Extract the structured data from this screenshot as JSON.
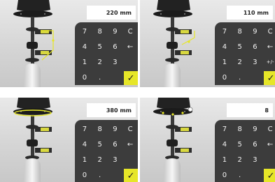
{
  "panels": [
    {
      "readout": "220 mm",
      "keys": [
        "7",
        "8",
        "9",
        "C",
        "4",
        "5",
        "6",
        "←",
        "1",
        "2",
        "3",
        "",
        "0",
        ".",
        "",
        "✓"
      ]
    },
    {
      "readout": "110 mm",
      "keys": [
        "7",
        "8",
        "9",
        "C",
        "4",
        "5",
        "6",
        "←",
        "1",
        "2",
        "3",
        "+/-",
        "0",
        ".",
        "",
        "✓"
      ]
    },
    {
      "readout": "380 mm",
      "keys": [
        "7",
        "8",
        "9",
        "C",
        "4",
        "5",
        "6",
        "←",
        "1",
        "2",
        "3",
        "",
        "0",
        ".",
        "",
        "✓"
      ]
    },
    {
      "readout": "8",
      "keys": [
        "7",
        "8",
        "9",
        "C",
        "4",
        "5",
        "6",
        "←",
        "1",
        "2",
        "3",
        "",
        "0",
        ".",
        "",
        "✓"
      ]
    }
  ],
  "colors": {
    "keypad_bg": "#3c3c3c",
    "confirm_key": "#e6e628",
    "measure_highlight": "#e6e628"
  },
  "icons": {
    "backspace": "left-arrow-icon",
    "confirm": "checkmark-icon"
  }
}
